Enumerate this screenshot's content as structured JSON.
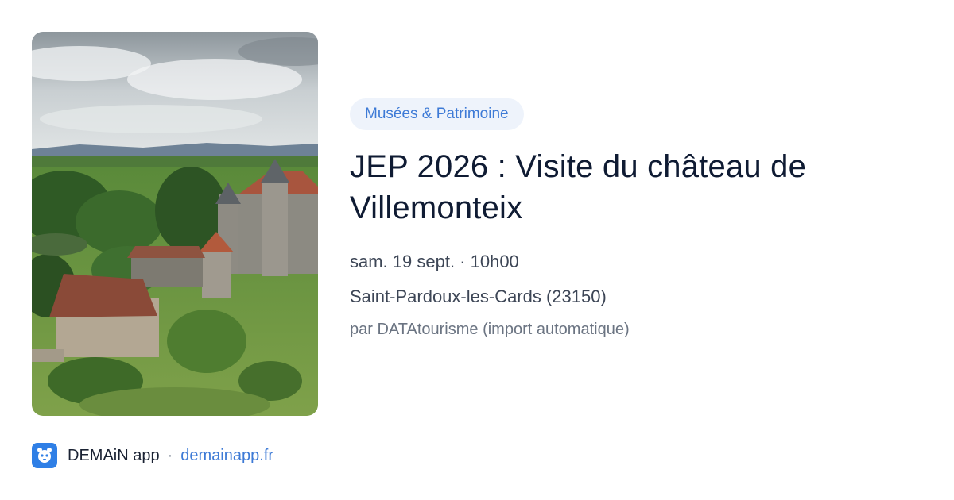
{
  "event": {
    "category": "Musées & Patrimoine",
    "title": "JEP 2026 : Visite du château de Villemonteix",
    "datetime": "sam. 19 sept. · 10h00",
    "location": "Saint-Pardoux-les-Cards (23150)",
    "source": "par DATAtourisme (import automatique)",
    "image": "chateau-photo"
  },
  "footer": {
    "app_name": "DEMAiN app",
    "separator": "·",
    "link": "demainapp.fr",
    "logo_icon": "demain-app-logo-icon"
  },
  "colors": {
    "accent": "#3d7ad6",
    "category_bg": "#eef3fb",
    "title": "#0f1b33"
  }
}
